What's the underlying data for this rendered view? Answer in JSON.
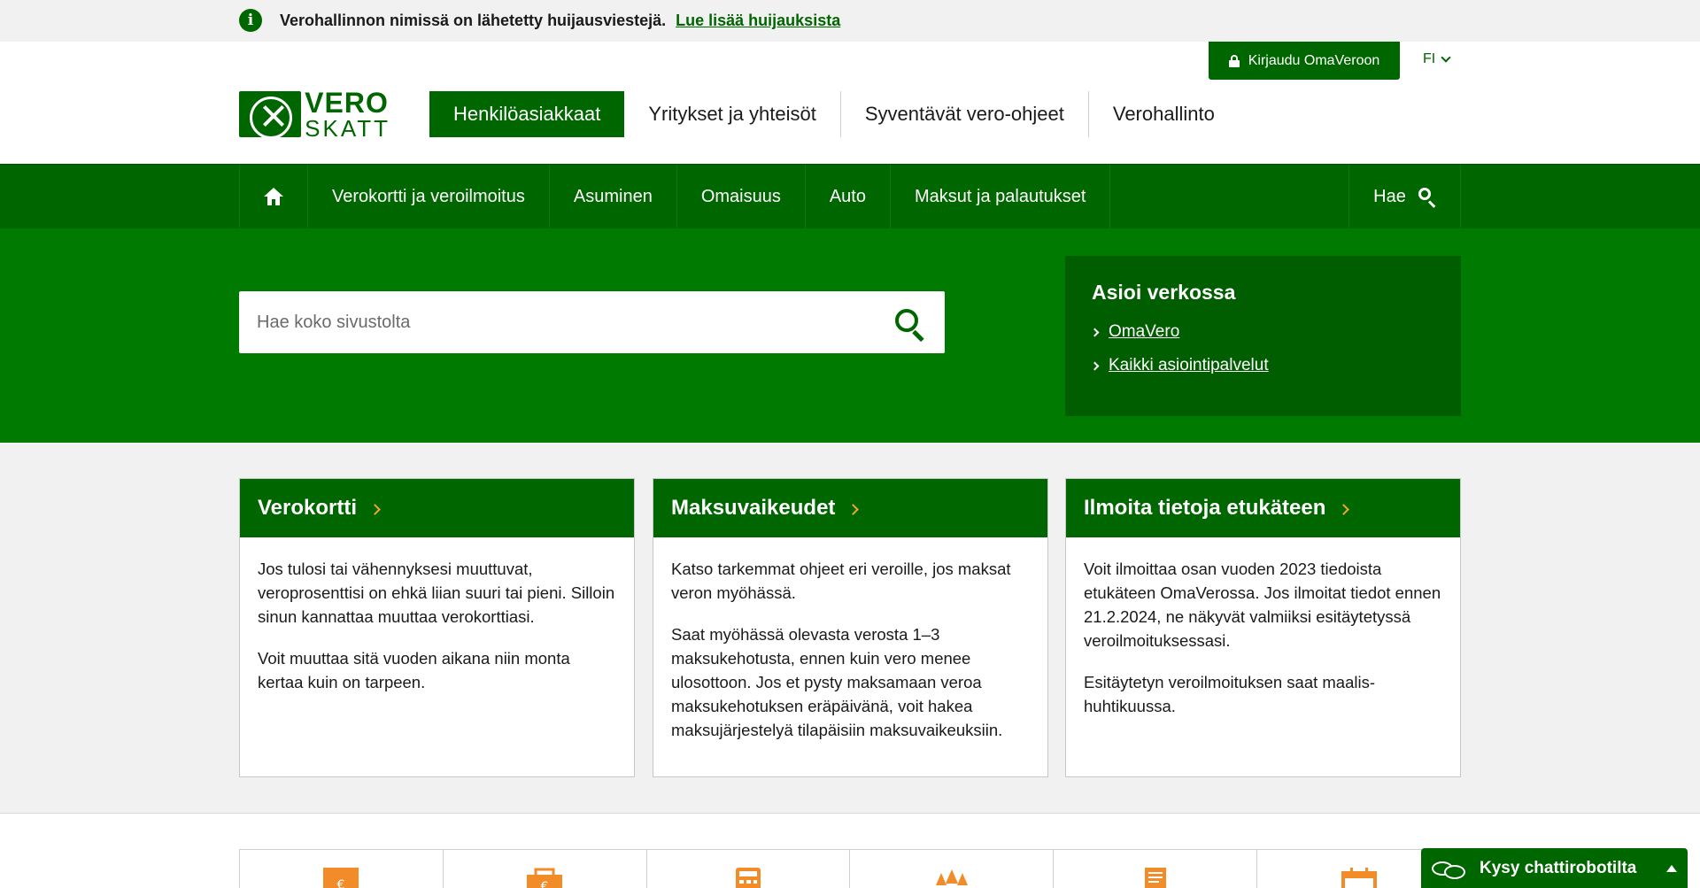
{
  "notice": {
    "text": "Verohallinnon nimissä on lähetetty huijausviestejä.",
    "link": "Lue lisää huijauksista"
  },
  "header": {
    "login_label": "Kirjaudu OmaVeroon",
    "language": "FI",
    "logo_line1": "VERO",
    "logo_line2": "SKATT",
    "audience_nav": [
      {
        "label": "Henkilöasiakkaat",
        "active": true
      },
      {
        "label": "Yritykset ja yhteisöt"
      },
      {
        "label": "Syventävät vero-ohjeet"
      },
      {
        "label": "Verohallinto"
      }
    ]
  },
  "main_nav": {
    "items": [
      {
        "label": "Verokortti ja veroilmoitus"
      },
      {
        "label": "Asuminen"
      },
      {
        "label": "Omaisuus"
      },
      {
        "label": "Auto"
      },
      {
        "label": "Maksut ja palautukset"
      }
    ],
    "search_label": "Hae"
  },
  "hero": {
    "search_placeholder": "Hae koko sivustolta",
    "asioi_title": "Asioi verkossa",
    "asioi_links": [
      "OmaVero",
      "Kaikki asiointipalvelut"
    ]
  },
  "cards": [
    {
      "title": "Verokortti",
      "paragraphs": [
        "Jos tulosi tai vähennyksesi muuttuvat, veroprosenttisi on ehkä liian suuri tai pieni. Silloin sinun kannattaa muuttaa verokorttiasi.",
        "Voit muuttaa sitä vuoden aikana niin monta kertaa kuin on tarpeen."
      ]
    },
    {
      "title": "Maksuvaikeudet",
      "paragraphs": [
        "Katso tarkemmat ohjeet eri veroille, jos maksat veron myöhässä.",
        "Saat myöhässä olevasta verosta 1–3 maksukehotusta, ennen kuin vero menee ulosottoon. Jos et pysty maksamaan veroa maksukehotuksen eräpäivänä, voit hakea maksujärjestelyä tilapäisiin maksuvaikeuksiin."
      ]
    },
    {
      "title": "Ilmoita tietoja etukäteen",
      "paragraphs": [
        "Voit ilmoittaa osan vuoden 2023 tiedoista etukäteen OmaVerossa. Jos ilmoitat tiedot ennen 21.2.2024, ne näkyvät valmiiksi esitäytetyssä veroilmoituksessasi.",
        "Esitäytetyn veroilmoituksen saat maalis-huhtikuussa."
      ]
    }
  ],
  "tiles": [
    {
      "icon": "house-euro-icon"
    },
    {
      "icon": "briefcase-euro-icon"
    },
    {
      "icon": "calculator-icon"
    },
    {
      "icon": "forest-icon"
    },
    {
      "icon": "document-icon"
    },
    {
      "icon": "calendar-icon"
    }
  ],
  "chat": {
    "label": "Kysy chattirobotilta"
  },
  "colors": {
    "brand_green": "#006600",
    "hero_green": "#007a00",
    "accent_orange": "#f5a623"
  }
}
